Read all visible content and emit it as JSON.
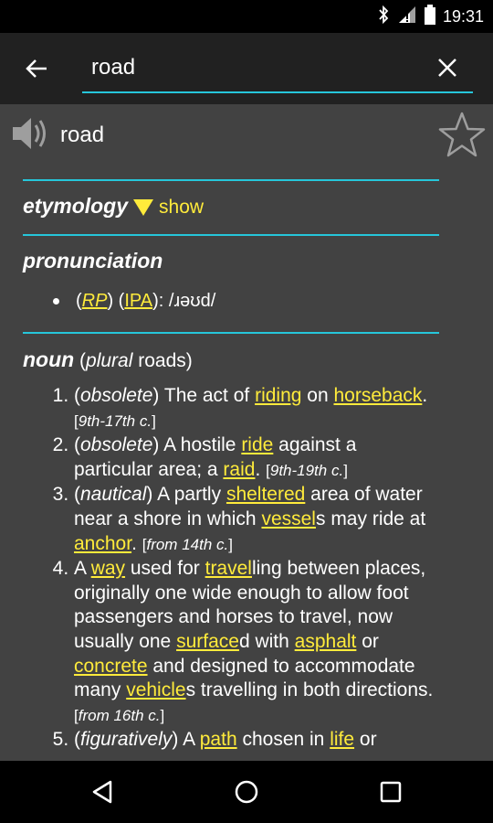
{
  "status": {
    "time": "19:31"
  },
  "search": {
    "value": "road",
    "placeholder": ""
  },
  "word": {
    "title": "road"
  },
  "etymology": {
    "label": "etymology",
    "toggle": "show"
  },
  "pronunciation": {
    "label": "pronunciation",
    "rp": "RP",
    "ipa": "IPA",
    "transcription": "/ɹəʊd/"
  },
  "pos": {
    "label": "noun",
    "plural_word": "plural",
    "plural_form": "roads"
  },
  "senses": [
    {
      "tag": "obsolete",
      "t1": " The act of ",
      "l1": "riding",
      "t2": " on ",
      "l2": "horseback",
      "t3": ". ",
      "date": "9th-17th c."
    },
    {
      "tag": "obsolete",
      "t1": " A hostile ",
      "l1": "ride",
      "t2": " against a particular area; a ",
      "l2": "raid",
      "t3": ". ",
      "date": "9th-19th c."
    },
    {
      "tag": "nautical",
      "t1": " A partly ",
      "l1": "sheltered",
      "t2": " area of water near a shore in which ",
      "l2": "vessel",
      "t3": "s may ride at ",
      "l3": "anchor",
      "t4": ". ",
      "date": "from 14th c."
    },
    {
      "t0": "A ",
      "l1": "way",
      "t1": " used for ",
      "l2": "travel",
      "t2": "ling between places, originally one wide enough to allow foot passengers and horses to travel, now usually one ",
      "l3": "surface",
      "t3": "d with ",
      "l4": "asphalt",
      "t4": " or ",
      "l5": "concrete",
      "t5": " and designed to accommodate many ",
      "l6": "vehicle",
      "t6": "s travelling in both directions. ",
      "date": "from 16th c."
    },
    {
      "tag": "figuratively",
      "t1": " A ",
      "l1": "path",
      "t2": " chosen in ",
      "l2": "life",
      "t3": " or"
    }
  ]
}
